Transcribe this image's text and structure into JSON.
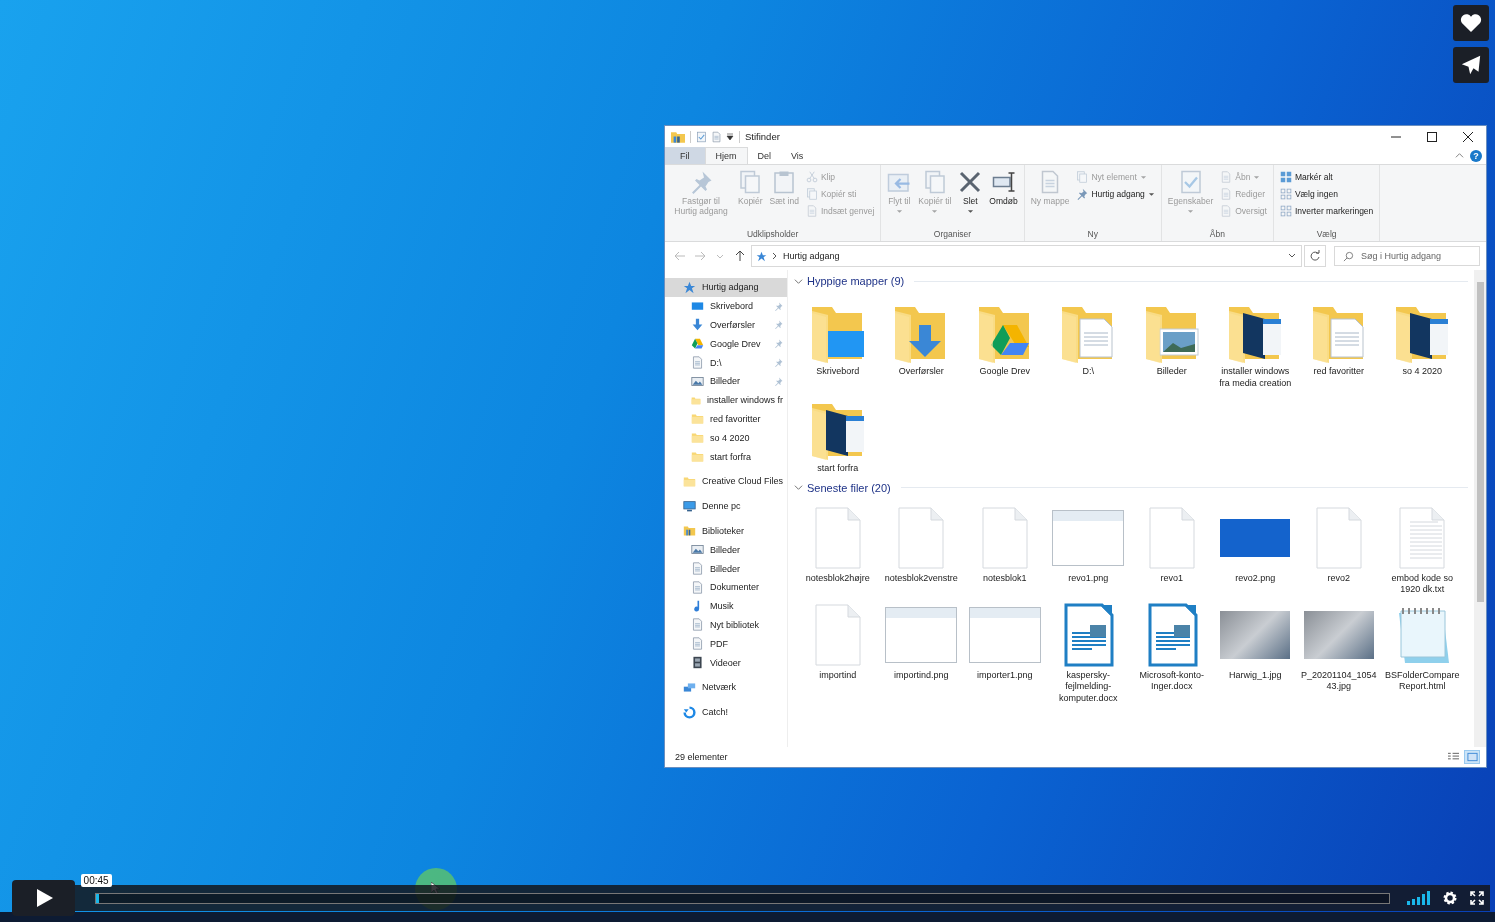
{
  "desktop": {
    "cursor_highlight": true
  },
  "window": {
    "title": "Stifinder",
    "tabs": [
      {
        "label": "Fil",
        "kind": "file",
        "selected": false
      },
      {
        "label": "Hjem",
        "kind": "tab",
        "selected": true
      },
      {
        "label": "Del",
        "kind": "tab",
        "selected": false
      },
      {
        "label": "Vis",
        "kind": "tab",
        "selected": false
      }
    ],
    "help_button": "?",
    "ribbon": [
      {
        "label": "Udklipsholder",
        "commands": [
          {
            "label": "Fastgør til Hurtig adgang",
            "kind": "large",
            "disabled": true,
            "dropdown": false
          },
          {
            "label": "Kopiér",
            "kind": "large",
            "disabled": true,
            "dropdown": false
          },
          {
            "label": "Sæt ind",
            "kind": "large",
            "disabled": true,
            "dropdown": false
          },
          {
            "label": "Klip",
            "kind": "small",
            "disabled": true,
            "dropdown": false
          },
          {
            "label": "Kopiér sti",
            "kind": "small",
            "disabled": true,
            "dropdown": false
          },
          {
            "label": "Indsæt genvej",
            "kind": "small",
            "disabled": true,
            "dropdown": false
          }
        ]
      },
      {
        "label": "Organiser",
        "commands": [
          {
            "label": "Flyt til",
            "kind": "large",
            "disabled": true,
            "dropdown": true
          },
          {
            "label": "Kopiér til",
            "kind": "large",
            "disabled": true,
            "dropdown": true
          },
          {
            "label": "Slet",
            "kind": "large",
            "disabled": false,
            "dropdown": true
          },
          {
            "label": "Omdøb",
            "kind": "large",
            "disabled": false,
            "dropdown": false
          }
        ]
      },
      {
        "label": "Ny",
        "commands": [
          {
            "label": "Ny mappe",
            "kind": "large",
            "disabled": true,
            "dropdown": false
          },
          {
            "label": "Nyt element",
            "kind": "small",
            "disabled": true,
            "dropdown": true
          },
          {
            "label": "Hurtig adgang",
            "kind": "small",
            "disabled": false,
            "dropdown": true
          }
        ]
      },
      {
        "label": "Åbn",
        "commands": [
          {
            "label": "Egenskaber",
            "kind": "large",
            "disabled": true,
            "dropdown": true
          },
          {
            "label": "Åbn",
            "kind": "small",
            "disabled": true,
            "dropdown": true
          },
          {
            "label": "Rediger",
            "kind": "small",
            "disabled": true,
            "dropdown": false
          },
          {
            "label": "Oversigt",
            "kind": "small",
            "disabled": true,
            "dropdown": false
          }
        ]
      },
      {
        "label": "Vælg",
        "commands": [
          {
            "label": "Markér alt",
            "kind": "small",
            "disabled": false,
            "dropdown": false
          },
          {
            "label": "Vælg ingen",
            "kind": "small",
            "disabled": false,
            "dropdown": false
          },
          {
            "label": "Inverter markeringen",
            "kind": "small",
            "disabled": false,
            "dropdown": false
          }
        ]
      }
    ],
    "address": {
      "path": "Hurtig adgang",
      "search_placeholder": "Søg i Hurtig adgang"
    },
    "navigation": [
      {
        "label": "Hurtig adgang",
        "kind": "star",
        "selected": true,
        "children": [
          {
            "label": "Skrivebord",
            "kind": "desktop",
            "selected": false,
            "pinned": true
          },
          {
            "label": "Overførsler",
            "kind": "download",
            "selected": false,
            "pinned": true
          },
          {
            "label": "Google Drev",
            "kind": "triangle",
            "selected": false,
            "pinned": true
          },
          {
            "label": "D:\\",
            "kind": "document",
            "selected": false,
            "pinned": true
          },
          {
            "label": "Billeder",
            "kind": "picture",
            "selected": false,
            "pinned": true
          },
          {
            "label": "installer windows fr",
            "kind": "folder",
            "selected": false,
            "pinned": false
          },
          {
            "label": "red favoritter",
            "kind": "folder",
            "selected": false,
            "pinned": false
          },
          {
            "label": "so 4 2020",
            "kind": "folder",
            "selected": false,
            "pinned": false
          },
          {
            "label": "start forfra",
            "kind": "folder",
            "selected": false,
            "pinned": false
          }
        ]
      },
      {
        "label": "Creative Cloud Files",
        "kind": "folder",
        "selected": false
      },
      {
        "label": "Denne pc",
        "kind": "computer",
        "selected": false
      },
      {
        "label": "Biblioteker",
        "kind": "library",
        "selected": false,
        "children": [
          {
            "label": "Billeder",
            "kind": "picture",
            "selected": false
          },
          {
            "label": "Billeder",
            "kind": "document",
            "selected": false
          },
          {
            "label": "Dokumenter",
            "kind": "document",
            "selected": false
          },
          {
            "label": "Musik",
            "kind": "music",
            "selected": false
          },
          {
            "label": "Nyt bibliotek",
            "kind": "document",
            "selected": false
          },
          {
            "label": "PDF",
            "kind": "document",
            "selected": false
          },
          {
            "label": "Videoer",
            "kind": "film",
            "selected": false
          }
        ]
      },
      {
        "label": "Netværk",
        "kind": "network",
        "selected": false
      },
      {
        "label": "Catch!",
        "kind": "circle",
        "selected": false
      }
    ],
    "sections": [
      {
        "title": "Hyppige mapper (9)",
        "expanded": true,
        "items": [
          {
            "label": "Skrivebord",
            "kind": "folder-desktop"
          },
          {
            "label": "Overførsler",
            "kind": "folder-download"
          },
          {
            "label": "Google Drev",
            "kind": "folder-triangle"
          },
          {
            "label": "D:\\",
            "kind": "folder-document"
          },
          {
            "label": "Billeder",
            "kind": "folder-picture"
          },
          {
            "label": "installer windows fra media creation",
            "kind": "folder-screenshot"
          },
          {
            "label": "red favoritter",
            "kind": "folder-document"
          },
          {
            "label": "so 4 2020",
            "kind": "folder-screenshot"
          },
          {
            "label": "start forfra",
            "kind": "folder-screenshot"
          }
        ]
      },
      {
        "title": "Seneste filer (20)",
        "expanded": true,
        "items": [
          {
            "label": "notesblok2højre",
            "kind": "blank"
          },
          {
            "label": "notesblok2venstre",
            "kind": "blank"
          },
          {
            "label": "notesblok1",
            "kind": "blank"
          },
          {
            "label": "revo1.png",
            "kind": "screenshot"
          },
          {
            "label": "revo1",
            "kind": "blank"
          },
          {
            "label": "revo2.png",
            "kind": "screenshot-blue"
          },
          {
            "label": "revo2",
            "kind": "blank"
          },
          {
            "label": "embod kode so 1920 dk.txt",
            "kind": "text"
          },
          {
            "label": "importind",
            "kind": "blank"
          },
          {
            "label": "importind.png",
            "kind": "screenshot"
          },
          {
            "label": "importer1.png",
            "kind": "screenshot"
          },
          {
            "label": "kaspersky-fejlmelding-komputer.docx",
            "kind": "docx"
          },
          {
            "label": "Microsoft-konto-Inger.docx",
            "kind": "docx"
          },
          {
            "label": "Harwig_1.jpg",
            "kind": "photo"
          },
          {
            "label": "P_20201104_105443.jpg",
            "kind": "photo"
          },
          {
            "label": "BSFolderCompareReport.html",
            "kind": "notepad"
          }
        ]
      }
    ],
    "status": "29 elementer",
    "views": [
      {
        "kind": "details",
        "selected": false
      },
      {
        "kind": "large-icons",
        "selected": true
      }
    ]
  },
  "player": {
    "playing": false,
    "time": "00:45",
    "progress": {
      "level": 0.002
    }
  }
}
